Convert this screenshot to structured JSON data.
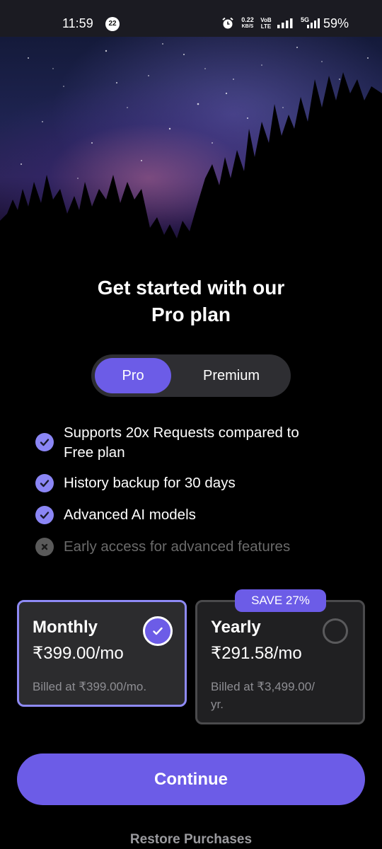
{
  "status_bar": {
    "time": "11:59",
    "notification_count": "22",
    "speed_value": "0.22",
    "speed_unit": "KB/S",
    "volte_top": "VoB",
    "volte_bottom": "LTE",
    "network": "5G",
    "battery": "59%",
    "icons": [
      "alarm-icon",
      "signal-icon",
      "signal-icon"
    ]
  },
  "hero": {
    "image": "starry-night-sky-forest"
  },
  "title": {
    "line1": "Get started with our",
    "line2": "Pro plan"
  },
  "plan_toggle": {
    "active": "Pro",
    "options": [
      "Pro",
      "Premium"
    ]
  },
  "features": [
    {
      "text": "Supports 20x Requests compared to",
      "text2": "Free plan",
      "included": true
    },
    {
      "text": "History backup for 30 days",
      "included": true
    },
    {
      "text": "Advanced AI models",
      "included": true
    },
    {
      "text": "Early access for advanced features",
      "included": false
    }
  ],
  "plans": {
    "monthly": {
      "title": "Monthly",
      "price": "₹399.00/mo",
      "billing": "Billed at ₹399.00/mo.",
      "selected": true
    },
    "yearly": {
      "title": "Yearly",
      "price": "₹291.58/mo",
      "billing_line1": "Billed at ₹3,499.00/",
      "billing_line2": "yr.",
      "badge": "SAVE 27%",
      "selected": false
    }
  },
  "continue_label": "Continue",
  "restore_label": "Restore Purchases",
  "colors": {
    "accent": "#6c5ce7",
    "check": "#8b86f5",
    "background": "#000000"
  }
}
